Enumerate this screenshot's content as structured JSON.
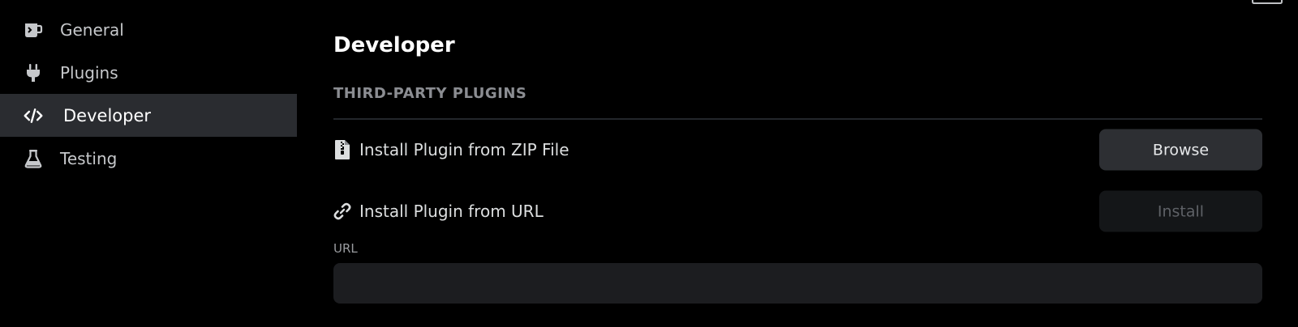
{
  "sidebar": {
    "items": [
      {
        "label": "General",
        "icon": "mug-icon",
        "active": false
      },
      {
        "label": "Plugins",
        "icon": "plug-icon",
        "active": false
      },
      {
        "label": "Developer",
        "icon": "code-icon",
        "active": true
      },
      {
        "label": "Testing",
        "icon": "flask-icon",
        "active": false
      }
    ]
  },
  "main": {
    "title": "Developer",
    "section_header": "THIRD-PARTY PLUGINS",
    "zip_row": {
      "label": "Install Plugin from ZIP File",
      "icon": "zip-file-icon",
      "button_label": "Browse"
    },
    "url_row": {
      "label": "Install Plugin from URL",
      "icon": "link-icon",
      "button_label": "Install",
      "button_disabled": true
    },
    "url_field": {
      "label": "URL",
      "value": "",
      "placeholder": ""
    }
  },
  "colors": {
    "background": "#000000",
    "sidebar_active": "#2a2c30",
    "button": "#2d2f33",
    "button_disabled": "#141618",
    "input": "#1c1d20",
    "divider": "#23262b"
  }
}
